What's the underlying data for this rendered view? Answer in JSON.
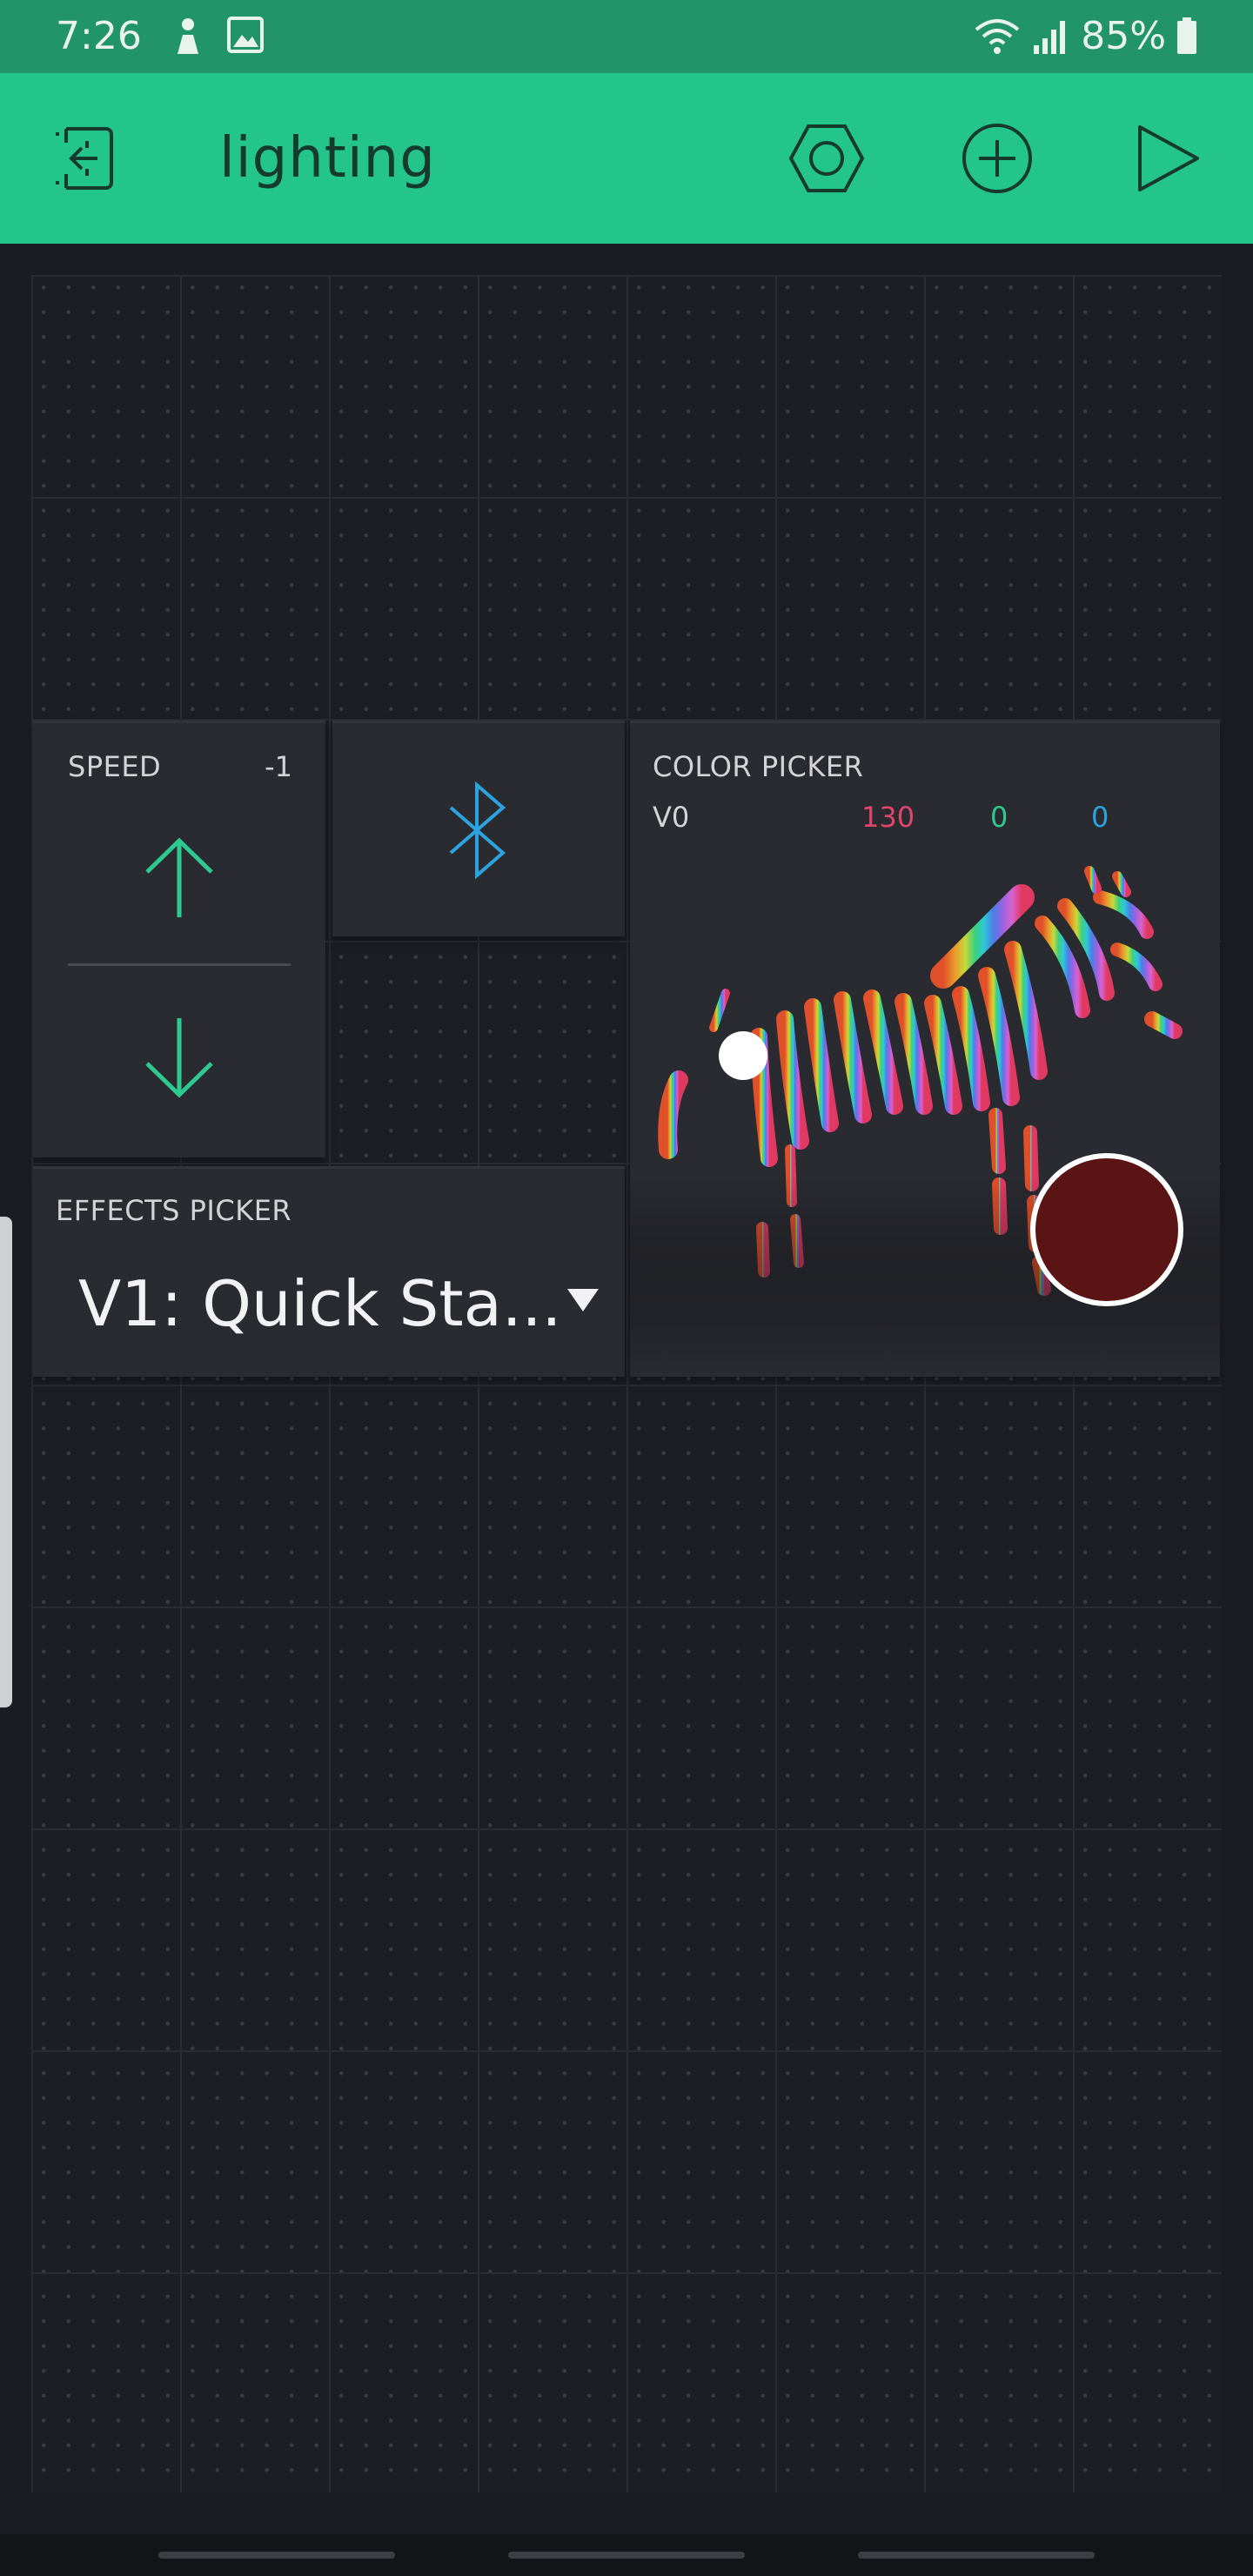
{
  "status_bar": {
    "time": "7:26",
    "battery": "85%"
  },
  "toolbar": {
    "title": "lighting"
  },
  "widgets": {
    "speed": {
      "label": "SPEED",
      "value": "-1"
    },
    "effects": {
      "label": "EFFECTS PICKER",
      "value": "V1: Quick Sta..."
    },
    "color_picker": {
      "label": "COLOR PICKER",
      "pin": "V0",
      "r": "130",
      "g": "0",
      "b": "0",
      "selected_color": "#5a1414"
    }
  },
  "colors": {
    "status_bar": "#21946a",
    "toolbar": "#24c48d",
    "accent_green": "#2ec98f",
    "bluetooth": "#2aa3e0",
    "red_value": "#e0456a",
    "green_value": "#2ec98f",
    "blue_value": "#2aa3e0"
  },
  "icons": {
    "back": "exit-to-left-icon",
    "settings": "hexagon-nut-icon",
    "add": "plus-circle-icon",
    "play": "play-icon",
    "bluetooth": "bluetooth-icon"
  }
}
